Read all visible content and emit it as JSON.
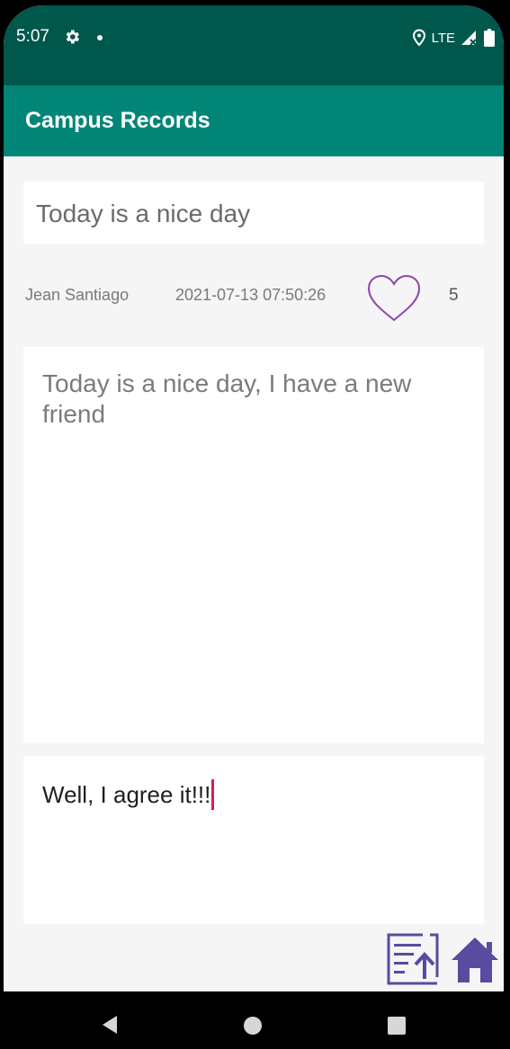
{
  "status_bar": {
    "time": "5:07",
    "network": "LTE",
    "icons": [
      "gear-icon",
      "location-icon",
      "signal-icon",
      "battery-icon"
    ]
  },
  "app_bar": {
    "title": "Campus Records"
  },
  "post": {
    "title": "Today is a nice day",
    "author": "Jean Santiago",
    "timestamp": "2021-07-13 07:50:26",
    "likes": "5",
    "content": "Today is a nice day, I have a new friend"
  },
  "comment": {
    "value": "Well, I agree it!!!"
  },
  "actions": {
    "upload_icon": "upload-icon",
    "home_icon": "home-icon"
  },
  "colors": {
    "status_bar": "#00574b",
    "app_bar": "#008577",
    "accent": "#d81b60",
    "heart": "#8e44ad",
    "action_icons": "#5a4aa0"
  }
}
